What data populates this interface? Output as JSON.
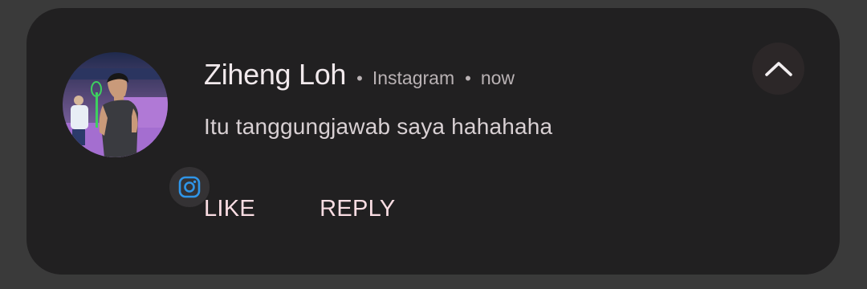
{
  "notification": {
    "sender": "Ziheng Loh",
    "separator": "•",
    "app_name": "Instagram",
    "time": "now",
    "message": "Itu tanggungjawab saya hahahaha",
    "actions": {
      "like_label": "LIKE",
      "reply_label": "REPLY"
    },
    "app_icon": "instagram-icon",
    "expand_icon": "chevron-up-icon"
  },
  "colors": {
    "card_background": "#212021",
    "page_background": "#3a3a3a",
    "action_text": "#fadde3",
    "instagram_icon": "#2f95e8"
  }
}
